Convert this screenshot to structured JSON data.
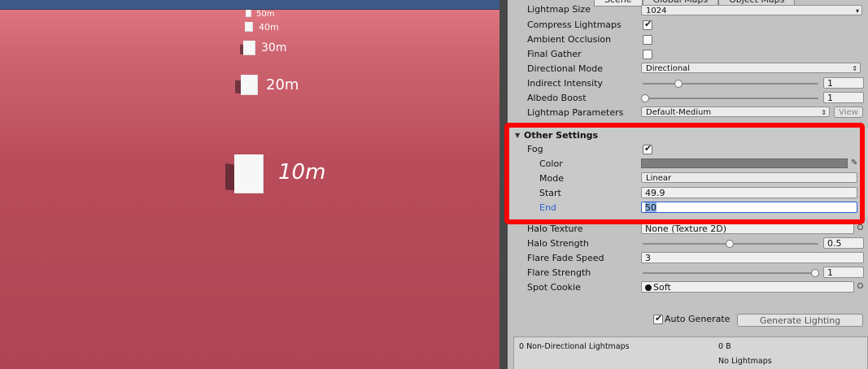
{
  "scene": {
    "markers": [
      {
        "label": "50m"
      },
      {
        "label": "40m"
      },
      {
        "label": "30m"
      },
      {
        "label": "20m"
      },
      {
        "label": "10m"
      }
    ]
  },
  "inspector": {
    "tabs": [
      {
        "label": "Scene"
      },
      {
        "label": "Global Maps"
      },
      {
        "label": "Object Maps"
      }
    ],
    "lightmap_size": {
      "label": "Lightmap Size",
      "value": "1024"
    },
    "compress_lightmaps": {
      "label": "Compress Lightmaps",
      "checked": true
    },
    "ambient_occlusion": {
      "label": "Ambient Occlusion",
      "checked": false
    },
    "final_gather": {
      "label": "Final Gather",
      "checked": false
    },
    "directional_mode": {
      "label": "Directional Mode",
      "value": "Directional"
    },
    "indirect_intensity": {
      "label": "Indirect Intensity",
      "value": "1"
    },
    "albedo_boost": {
      "label": "Albedo Boost",
      "value": "1"
    },
    "lightmap_parameters": {
      "label": "Lightmap Parameters",
      "value": "Default-Medium",
      "view_label": "View"
    },
    "other_settings": {
      "title": "Other Settings",
      "fog": {
        "label": "Fog",
        "checked": true
      },
      "color": {
        "label": "Color",
        "swatch": "#7d7d7d"
      },
      "mode": {
        "label": "Mode",
        "value": "Linear"
      },
      "start": {
        "label": "Start",
        "value": "49.9"
      },
      "end": {
        "label": "End",
        "value": "50"
      }
    },
    "halo_texture": {
      "label": "Halo Texture",
      "value": "None (Texture 2D)"
    },
    "halo_strength": {
      "label": "Halo Strength",
      "value": "0.5"
    },
    "flare_fade_speed": {
      "label": "Flare Fade Speed",
      "value": "3"
    },
    "flare_strength": {
      "label": "Flare Strength",
      "value": "1"
    },
    "spot_cookie": {
      "label": "Spot Cookie",
      "value": "Soft"
    },
    "auto_generate": {
      "label": "Auto Generate",
      "checked": true
    },
    "generate_lighting": {
      "label": "Generate Lighting"
    },
    "stats": {
      "lightmaps": "0 Non-Directional Lightmaps",
      "size": "0 B",
      "status": "No Lightmaps"
    }
  },
  "colors": {
    "highlight_box": "#ff0000",
    "active_label": "#2a5fd1",
    "selection": "#8fb3e8"
  }
}
